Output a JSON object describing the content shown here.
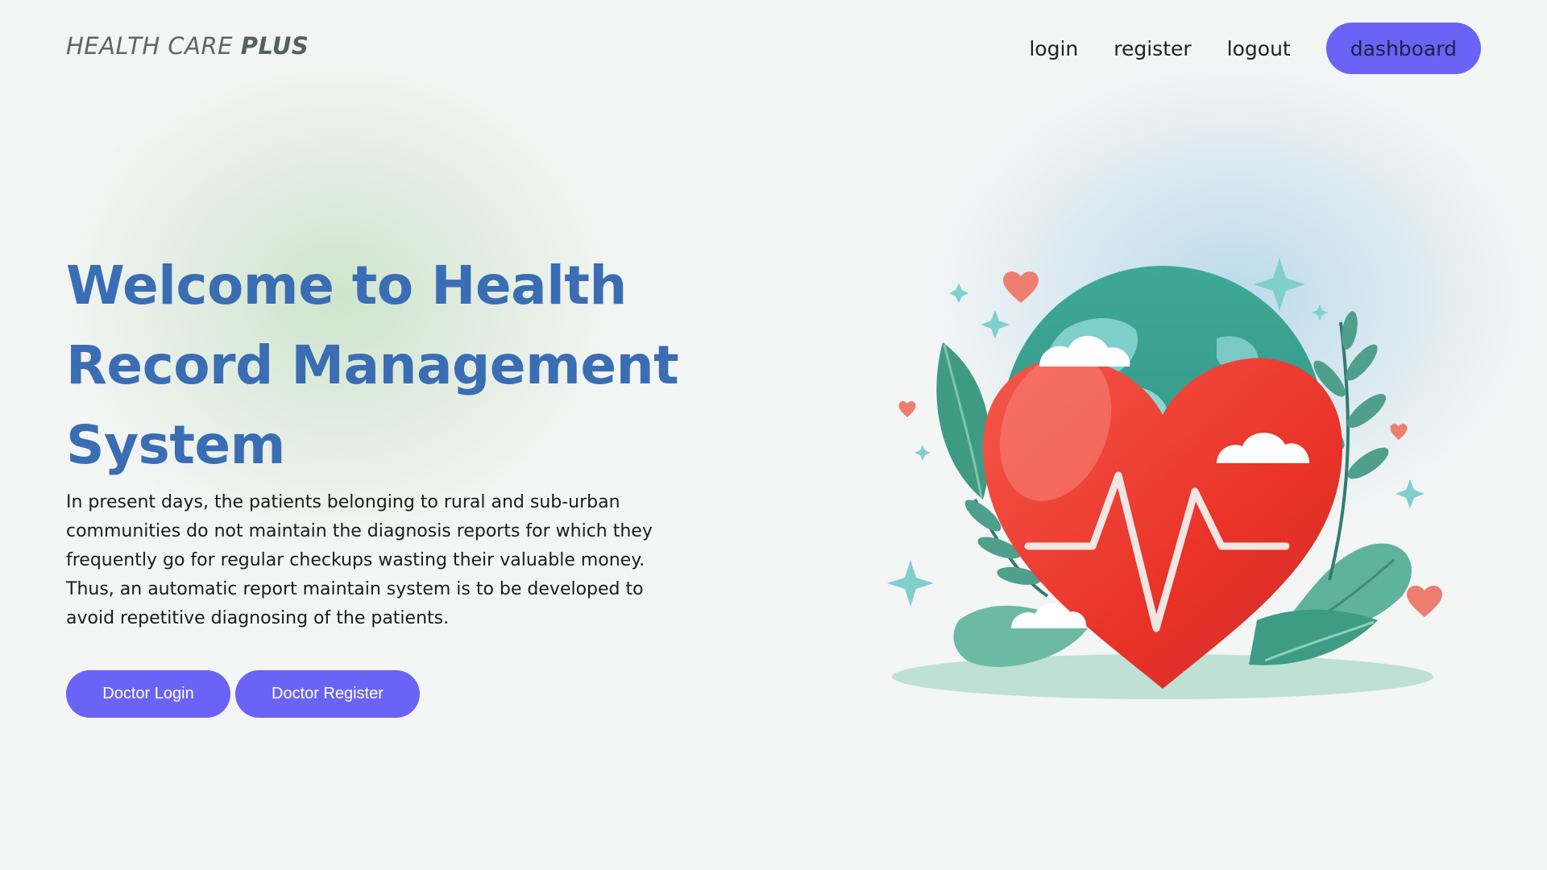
{
  "header": {
    "brand_prefix": "HEALTH CARE",
    "brand_suffix": "PLUS",
    "nav": {
      "login": "login",
      "register": "register",
      "logout": "logout",
      "dashboard": "dashboard"
    }
  },
  "hero": {
    "title": "Welcome to Health Record Management System",
    "description": "In present days, the patients belonging to rural and sub-urban communities do not maintain the diagnosis reports for which they frequently go for regular checkups wasting their valuable money. Thus, an automatic report maintain system is to be developed to avoid repetitive diagnosing of the patients.",
    "buttons": {
      "doctor_login": "Doctor Login",
      "doctor_register": "Doctor Register"
    }
  },
  "illustration": {
    "icons": [
      "heart-icon",
      "globe-icon",
      "heartbeat-line-icon",
      "leaf-icon",
      "sparkle-icon",
      "cloud-icon"
    ]
  },
  "colors": {
    "accent": "#6a63f5",
    "title": "#3a6db3",
    "heart": "#ee3a34",
    "globe": "#2f9f8c"
  }
}
